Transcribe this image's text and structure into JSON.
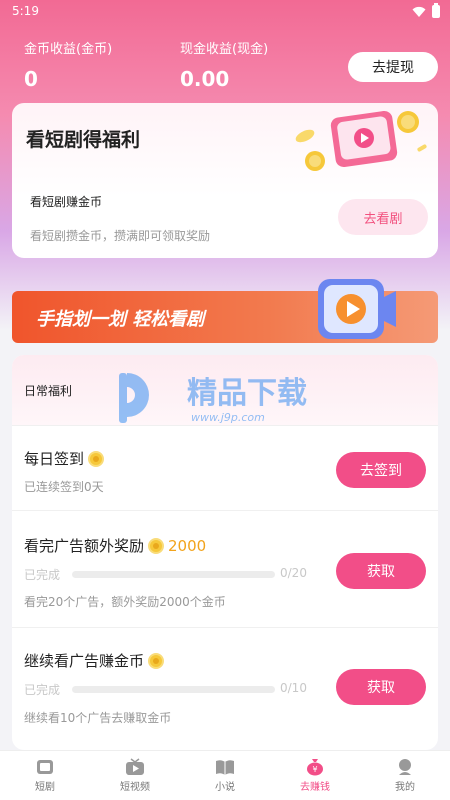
{
  "status": {
    "time": "5:19"
  },
  "earnings": {
    "coin_label": "金币收益(金币)",
    "coin_value": "0",
    "cash_label": "现金收益(现金)",
    "cash_value": "0.00",
    "withdraw_label": "去提现"
  },
  "drama_card": {
    "title": "看短剧得福利",
    "subtitle": "看短剧赚金币",
    "desc": "看短剧攒金币，攒满即可领取奖励",
    "button": "去看剧"
  },
  "banner": {
    "text": "手指划一划 轻松看剧"
  },
  "daily": {
    "title": "日常福利",
    "watermark": {
      "main": "精品下载",
      "sub": "www.j9p.com"
    },
    "tasks": [
      {
        "title": "每日签到",
        "sub": "已连续签到0天",
        "button": "去签到"
      },
      {
        "title": "看完广告额外奖励",
        "bonus": "2000",
        "progress_label": "已完成",
        "progress_count": "0/20",
        "progress": 0,
        "sub": "看完20个广告，额外奖励2000个金币",
        "button": "获取"
      },
      {
        "title": "继续看广告赚金币",
        "progress_label": "已完成",
        "progress_count": "0/10",
        "progress": 0,
        "sub": "继续看10个广告去赚取金币",
        "button": "获取"
      }
    ]
  },
  "nav": {
    "items": [
      {
        "label": "短剧",
        "icon": "drama-icon"
      },
      {
        "label": "短视频",
        "icon": "tv-icon"
      },
      {
        "label": "小说",
        "icon": "book-icon"
      },
      {
        "label": "去赚钱",
        "icon": "money-bag-icon",
        "active": true
      },
      {
        "label": "我的",
        "icon": "user-icon"
      }
    ]
  },
  "colors": {
    "accent": "#f24e88",
    "banner": "#f0552c",
    "coin": "#f6c83a"
  }
}
